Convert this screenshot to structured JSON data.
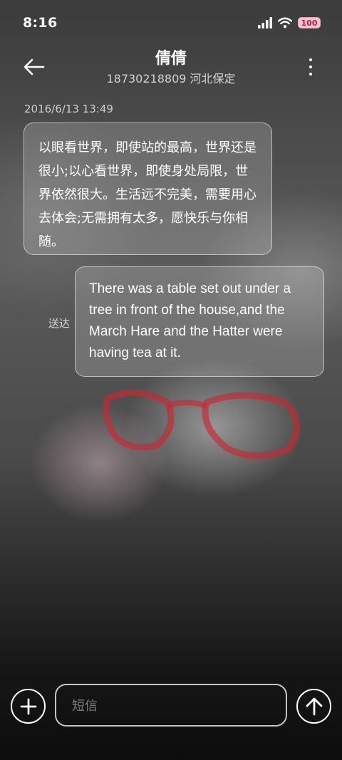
{
  "status_bar": {
    "time": "8:16",
    "battery": "100",
    "icons": [
      "signal-icon",
      "wifi-icon",
      "battery-icon"
    ]
  },
  "header": {
    "contact_name": "倩倩",
    "contact_subtitle": "18730218809 河北保定",
    "back_icon": "arrow-left-icon",
    "more_icon": "more-vertical-icon"
  },
  "conversation": {
    "timestamp": "2016/6/13 13:49",
    "messages": [
      {
        "direction": "incoming",
        "text": "以眼看世界，即使站的最高，世界还是很小;以心看世界，即使身处局限，世界依然很大。生活远不完美，需要用心去体会;无需拥有太多，愿快乐与你相随。"
      },
      {
        "direction": "outgoing",
        "text": "There was a table set out under a tree in front of the house,and the March Hare and the Hatter were having tea at it.",
        "status": "送达"
      }
    ]
  },
  "composer": {
    "placeholder": "短信",
    "add_icon": "plus-icon",
    "send_icon": "arrow-up-icon"
  }
}
